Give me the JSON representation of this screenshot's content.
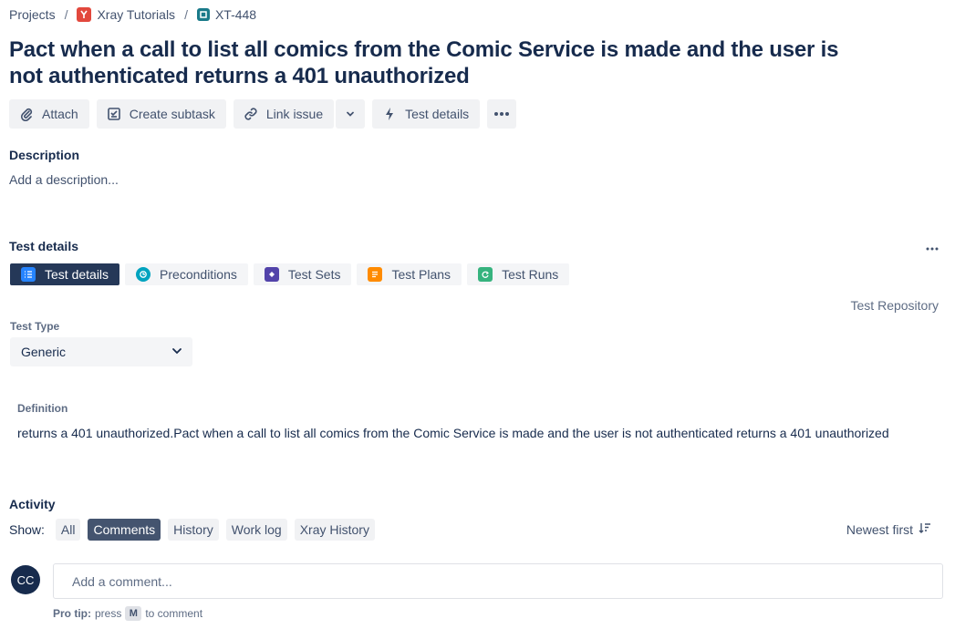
{
  "breadcrumb": {
    "projects": "Projects",
    "project": "Xray Tutorials",
    "issue_key": "XT-448",
    "separator": "/"
  },
  "issue": {
    "title": "Pact when a call to list all comics from the Comic Service is made and the user is not authenticated returns a 401 unauthorized"
  },
  "toolbar": {
    "attach": "Attach",
    "create_subtask": "Create subtask",
    "link_issue": "Link issue",
    "test_details": "Test details"
  },
  "description": {
    "heading": "Description",
    "placeholder": "Add a description..."
  },
  "test_details": {
    "heading": "Test details",
    "tabs": [
      {
        "label": "Test details",
        "icon": "list-icon",
        "color": "#2684ff",
        "active": true
      },
      {
        "label": "Preconditions",
        "icon": "precondition-icon",
        "color": "#00a3bf",
        "active": false
      },
      {
        "label": "Test Sets",
        "icon": "test-set-icon",
        "color": "#6554c0",
        "active": false
      },
      {
        "label": "Test Plans",
        "icon": "test-plan-icon",
        "color": "#ff8b00",
        "active": false
      },
      {
        "label": "Test Runs",
        "icon": "test-run-icon",
        "color": "#36b37e",
        "active": false
      }
    ],
    "repository_link": "Test Repository",
    "test_type_label": "Test Type",
    "test_type_value": "Generic",
    "definition_label": "Definition",
    "definition_text": "returns a 401 unauthorized.Pact when a call to list all comics from the Comic Service is made and the user is not authenticated returns a 401 unauthorized"
  },
  "activity": {
    "heading": "Activity",
    "show_label": "Show:",
    "filters": [
      {
        "label": "All",
        "active": false
      },
      {
        "label": "Comments",
        "active": true
      },
      {
        "label": "History",
        "active": false
      },
      {
        "label": "Work log",
        "active": false
      },
      {
        "label": "Xray History",
        "active": false
      }
    ],
    "sort_label": "Newest first",
    "avatar_initials": "CC",
    "comment_placeholder": "Add a comment...",
    "protip_prefix": "Pro tip:",
    "protip_press": "press",
    "protip_key": "M",
    "protip_suffix": "to comment"
  }
}
